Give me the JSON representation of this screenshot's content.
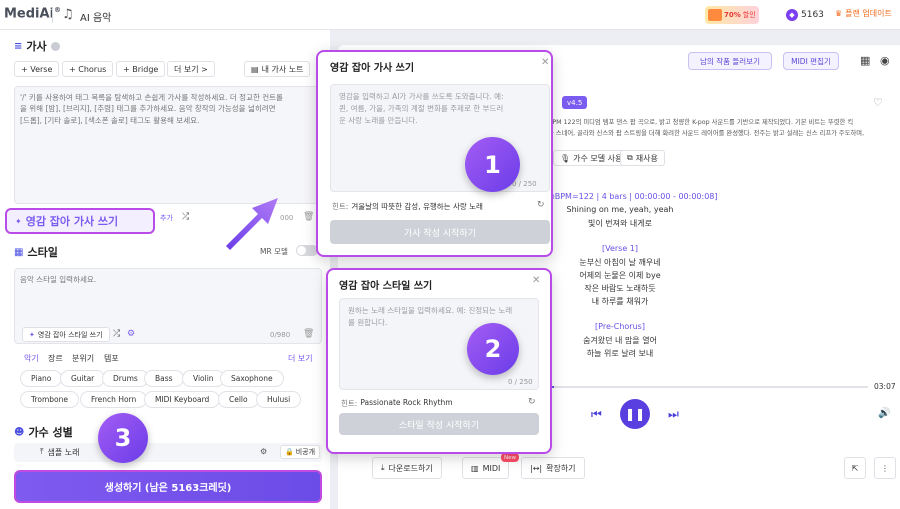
{
  "topbar": {
    "logo": "MediAi",
    "logo_mark": "®",
    "section_title": "AI 음악",
    "promo_pct": "70%",
    "promo_text": "할인",
    "credits": "5163",
    "upgrade": "플랜 업데이트"
  },
  "lyrics_section": {
    "title": "가사",
    "tags": [
      "+ Verse",
      "+ Chorus",
      "+ Bridge",
      "더 보기 >"
    ],
    "notes_button": "내 가사 노트",
    "placeholder_lines": [
      "'/' 키를 사용하여 태그 목록을 탐색하고 손쉽게 가사를 작성하세요. 더 정교한 컨트롤",
      "을 위해 [밤], [브리지], [추렴] 태그를 추가하세요. 음악 창작의 가능성을 넓히려면",
      "[드롭], [기타 솔로], [색소폰 솔로] 태그도 활용해 보세요."
    ],
    "inspiration_button": "영감 잡아 가사 쓰기",
    "extra_label": "추가",
    "counter": "000"
  },
  "style_section": {
    "title": "스타일",
    "mr_label": "MR 모델",
    "placeholder": "음악 스타일 입력하세요.",
    "inspiration_button": "영감 잡아 스타일 쓰기",
    "counter": "0/980",
    "tabs": [
      "악기",
      "장르",
      "분위기",
      "템포"
    ],
    "more": "더 보기",
    "instruments": [
      "Piano",
      "Guitar",
      "Drums",
      "Bass",
      "Violin",
      "Saxophone",
      "Trombone",
      "French Horn",
      "MIDI Keyboard",
      "Cello",
      "Hulusi"
    ]
  },
  "vocal_section": {
    "title": "가수 성별",
    "voice_button": "샘플 노래",
    "private_label": "비공개"
  },
  "generate_button": "생성하기 (남은 5163크레딧)",
  "right_panel": {
    "listen_button": "남의 작품 들러보기",
    "midi_editor_button": "MIDI 편집기",
    "version_badge": "v4.5",
    "desc_lines": [
      "BPM 122의 미디엄 템포 댄스 팝 곡으로, 밝고 청량한 K-pop 사운드를 기반으로 제작되었다. 기본 비트는 뚜렷한 킥",
      "과 스네어, 골라와 신스와 팝 스트링을 더해 화려한 사운드 레이어를 완성했다. 전주는 밝고 설레는 신스 리프가 주도하며,"
    ],
    "voice_model_button": "가수 모델 사용",
    "reuse_button": "재사용",
    "lyrics_lines": [
      {
        "text": "[Intro @BPM=122 | 4 bars | 00:00:00 - 00:00:08]",
        "section": true
      },
      {
        "text": "Shining on me, yeah, yeah",
        "section": false
      },
      {
        "text": "빛이 번져와 내게로",
        "section": false
      },
      {
        "text": "",
        "section": false
      },
      {
        "text": "[Verse 1]",
        "section": true
      },
      {
        "text": "눈부신 아침이 날 깨우네",
        "section": false
      },
      {
        "text": "어제의 눈물은 이제 bye",
        "section": false
      },
      {
        "text": "작은 바람도 노래하듯",
        "section": false
      },
      {
        "text": "내 하루를 채워가",
        "section": false
      },
      {
        "text": "",
        "section": false
      },
      {
        "text": "[Pre-Chorus]",
        "section": true
      },
      {
        "text": "숨겨왔던 내 맘을 열어",
        "section": false
      },
      {
        "text": "하늘 위로 날려 보내",
        "section": false
      }
    ],
    "duration": "03:07",
    "progress_fraction": 0.02,
    "download_button": "다운로드하기",
    "midi_button": "MIDI",
    "new_badge": "New",
    "extend_button": "확장하기"
  },
  "popup_lyrics": {
    "title": "영감 잡아 가사 쓰기",
    "placeholder_lines": [
      "영감을 입력하고 AI가 가사를 쓰도록 도와줍니다. 예:",
      "퀸, 여름, 가을, 가족의 계절 변화를 주제로 한 부드러",
      "운 사랑 노래를 만듭니다."
    ],
    "counter": "0 / 250",
    "hint_label": "힌트:",
    "hint": "겨울날의 따뜻한 감성, 유행하는 사랑 노래",
    "button": "가사 작성 시작하기",
    "badge": "1"
  },
  "popup_style": {
    "title": "영감 잡아 스타일 쓰기",
    "placeholder_lines": [
      "원하는 노래 스타일을 입력하세요. 예: 진정되는 노래",
      "를 원합니다."
    ],
    "counter": "0 / 250",
    "hint_label": "힌트:",
    "hint": "Passionate Rock Rhythm",
    "button": "스타일 작성 시작하기",
    "badge": "2"
  },
  "badge3": "3",
  "colors": {
    "accent": "#7b5cf0",
    "highlight_border": "#b94ce8",
    "badge_gradient_start": "#a45cf4",
    "badge_gradient_end": "#6a3de8"
  }
}
